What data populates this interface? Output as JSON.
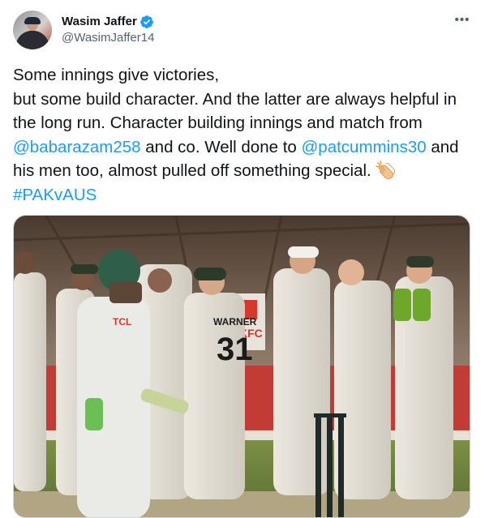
{
  "author": {
    "display_name": "Wasim Jaffer",
    "handle": "@WasimJaffer14",
    "verified": true,
    "avatar_icon": "profile-avatar"
  },
  "more_icon": "more-horizontal-icon",
  "tweet": {
    "line1": "Some innings give victories,",
    "line2a": "but some build character. And the latter are always helpful in the long run. Character building innings and match from ",
    "mention1": "@babarazam258",
    "line2b": " and co. Well done to ",
    "mention2": "@patcummins30",
    "line2c": " and his men too, almost pulled off something special. ",
    "emoji": "clapping-hands",
    "hashtag": "#PAKvAUS"
  },
  "media": {
    "type": "photo",
    "jersey_name": "WARNER",
    "jersey_number": "31",
    "sponsor_text": "TCL",
    "board_text": "KFC"
  },
  "colors": {
    "link": "#1d9bf0",
    "text": "#0f1419",
    "secondary": "#536471",
    "border": "#cfd9de"
  }
}
